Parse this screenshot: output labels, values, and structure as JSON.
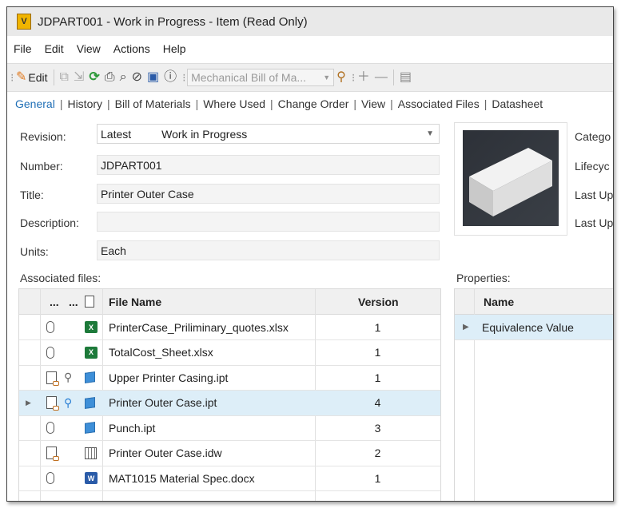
{
  "window": {
    "title": "JDPART001 - Work in Progress - Item (Read Only)",
    "logo_letter": "V"
  },
  "menu": [
    "File",
    "Edit",
    "View",
    "Actions",
    "Help"
  ],
  "toolbar": {
    "edit_label": "Edit",
    "bom_select": "Mechanical Bill of Ma..."
  },
  "tabs": [
    "General",
    "History",
    "Bill of Materials",
    "Where Used",
    "Change Order",
    "View",
    "Associated Files",
    "Datasheet"
  ],
  "fields": {
    "revision": {
      "label": "Revision:",
      "value": "Latest",
      "state": "Work in Progress"
    },
    "number": {
      "label": "Number:",
      "value": "JDPART001"
    },
    "title": {
      "label": "Title:",
      "value": "Printer Outer Case"
    },
    "description": {
      "label": "Description:",
      "value": ""
    },
    "units": {
      "label": "Units:",
      "value": "Each"
    }
  },
  "right_labels": [
    "Catego",
    "Lifecyc",
    "Last Up",
    "Last Up"
  ],
  "associated": {
    "label": "Associated files:",
    "headers": {
      "c1": "...",
      "c2": "...",
      "name": "File Name",
      "version": "Version"
    },
    "rows": [
      {
        "icon1": "attachment-icon",
        "icon2": "",
        "type": "excel-icon",
        "name": "PrinterCase_Priliminary_quotes.xlsx",
        "version": "1",
        "selected": false
      },
      {
        "icon1": "attachment-icon",
        "icon2": "",
        "type": "excel-icon",
        "name": "TotalCost_Sheet.xlsx",
        "version": "1",
        "selected": false
      },
      {
        "icon1": "linked-doc-icon",
        "icon2": "key-icon",
        "type": "part-icon",
        "name": "Upper Printer Casing.ipt",
        "version": "1",
        "selected": false
      },
      {
        "icon1": "linked-doc-icon",
        "icon2": "key-icon-blue",
        "type": "part-icon",
        "name": "Printer Outer Case.ipt",
        "version": "4",
        "selected": true
      },
      {
        "icon1": "attachment-icon",
        "icon2": "",
        "type": "part-icon",
        "name": "Punch.ipt",
        "version": "3",
        "selected": false
      },
      {
        "icon1": "linked-doc-icon",
        "icon2": "",
        "type": "drawing-icon",
        "name": "Printer Outer Case.idw",
        "version": "2",
        "selected": false
      },
      {
        "icon1": "attachment-icon",
        "icon2": "",
        "type": "word-icon",
        "name": "MAT1015 Material Spec.docx",
        "version": "1",
        "selected": false
      }
    ]
  },
  "properties": {
    "label": "Properties:",
    "header": "Name",
    "rows": [
      {
        "name": "Equivalence Value"
      }
    ]
  },
  "colors": {
    "accent": "#1f6fb6",
    "selected_row": "#ddeef8"
  }
}
